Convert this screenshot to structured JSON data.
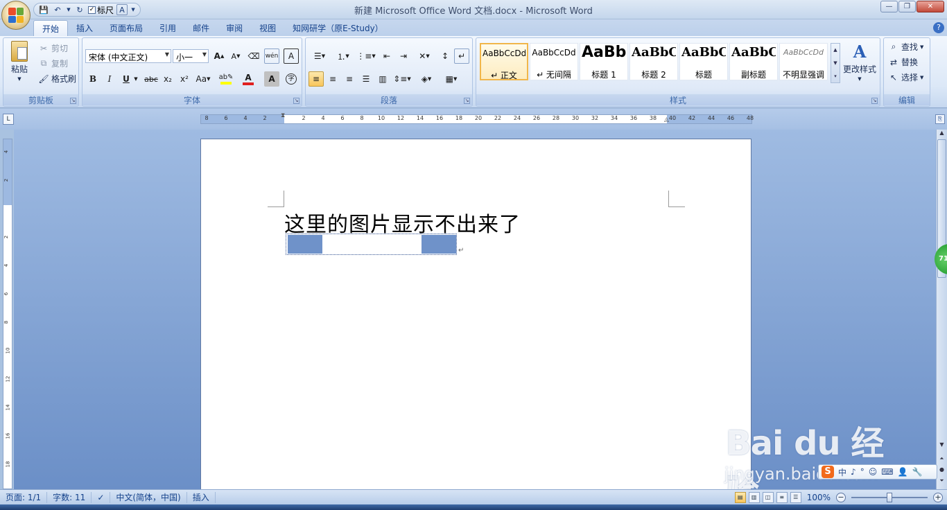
{
  "window": {
    "title": "新建 Microsoft Office Word 文档.docx - Microsoft Word"
  },
  "qat": {
    "ruler_label": "标尺"
  },
  "tabs": [
    {
      "label": "开始"
    },
    {
      "label": "插入"
    },
    {
      "label": "页面布局"
    },
    {
      "label": "引用"
    },
    {
      "label": "邮件"
    },
    {
      "label": "审阅"
    },
    {
      "label": "视图"
    },
    {
      "label": "知网研学（原E-Study）"
    }
  ],
  "ribbon": {
    "clipboard": {
      "label": "剪贴板",
      "paste": "粘贴",
      "cut": "剪切",
      "copy": "复制",
      "format_painter": "格式刷"
    },
    "font": {
      "label": "字体",
      "font_name": "宋体 (中文正文)",
      "font_size": "小一",
      "bold": "B",
      "italic": "I",
      "underline": "U",
      "strike": "abc",
      "subscript": "x₂",
      "superscript": "x²",
      "change_case": "Aa",
      "grow": "A",
      "shrink": "A",
      "phonetic": "wén",
      "char_border": "A",
      "font_color_letter": "A",
      "char_shading": "A",
      "enclose": "字"
    },
    "paragraph": {
      "label": "段落"
    },
    "styles": {
      "label": "样式",
      "items": [
        {
          "preview": "AaBbCcDd",
          "name": "↵ 正文"
        },
        {
          "preview": "AaBbCcDd",
          "name": "↵ 无间隔"
        },
        {
          "preview": "AaBb",
          "name": "标题 1"
        },
        {
          "preview": "AaBbC",
          "name": "标题 2"
        },
        {
          "preview": "AaBbC",
          "name": "标题"
        },
        {
          "preview": "AaBbC",
          "name": "副标题"
        },
        {
          "preview": "AaBbCcDd",
          "name": "不明显强调"
        }
      ],
      "change_styles": "更改样式"
    },
    "editing": {
      "label": "编辑",
      "find": "查找",
      "replace": "替换",
      "select": "选择"
    }
  },
  "ruler": {
    "h_ticks": [
      "8",
      "6",
      "4",
      "2",
      "",
      "2",
      "4",
      "6",
      "8",
      "10",
      "12",
      "14",
      "16",
      "18",
      "20",
      "22",
      "24",
      "26",
      "28",
      "30",
      "32",
      "34",
      "36",
      "38",
      "40",
      "42",
      "44",
      "46",
      "48"
    ],
    "v_ticks": [
      "4",
      "2",
      "",
      "2",
      "4",
      "6",
      "8",
      "10",
      "12",
      "14",
      "16",
      "18"
    ]
  },
  "document": {
    "text": "这里的图片显示不出来了"
  },
  "side_badge": "71",
  "watermark": {
    "main": "Bai du 经验",
    "sub": "jingyan.baidu.com"
  },
  "ime": {
    "logo": "S",
    "mode": "中"
  },
  "statusbar": {
    "page": "页面: 1/1",
    "words": "字数: 11",
    "language": "中文(简体，中国)",
    "mode": "插入",
    "zoom": "100%"
  },
  "colors": {
    "accent": "#15428b",
    "highlight": "#f8c55c",
    "font_color_bar": "#e02020",
    "highlight_bar": "#ffff00"
  }
}
